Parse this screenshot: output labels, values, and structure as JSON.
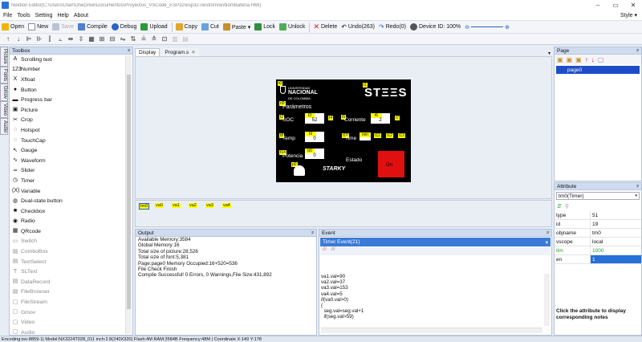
{
  "window": {
    "title": "Nextion Editor(C:\\Users\\User\\OneDrive\\Documentos\\Proyectos_VSCode_ESP32\\esp32-nextion\\nextion\\Bateria.HMI)",
    "controls": [
      "–",
      "▭",
      "✕"
    ]
  },
  "menu": {
    "items": [
      "File",
      "Tools",
      "Setting",
      "Help",
      "About"
    ],
    "style_label": "Style ▾"
  },
  "toolbar": {
    "open": "Open",
    "new": "New",
    "save": "Save",
    "compile": "Compile",
    "debug": "Debug",
    "upload": "Upload",
    "copy": "Copy",
    "cut": "Cut",
    "paste": "Paste ▾",
    "lock": "Lock",
    "unlock": "Unlock",
    "delete": "Delete",
    "undo": "Undo(263)",
    "redo": "Redo(0)",
    "device_id": "Device ID: 100%"
  },
  "left_vertical_tabs": [
    "Picture",
    "Fonts",
    "Gmov",
    "Video",
    "Audio"
  ],
  "toolbox": {
    "title": "Toolbox",
    "pin": "ᵖ",
    "items": [
      {
        "label": "Scrolling text",
        "icon": "A",
        "enabled": true
      },
      {
        "label": "Number",
        "icon": "123",
        "enabled": true
      },
      {
        "label": "Xfloat",
        "icon": "X",
        "enabled": true
      },
      {
        "label": "Button",
        "icon": "●",
        "enabled": true
      },
      {
        "label": "Progress bar",
        "icon": "▬",
        "enabled": true
      },
      {
        "label": "Picture",
        "icon": "▣",
        "enabled": true
      },
      {
        "label": "Crop",
        "icon": "✂",
        "enabled": true
      },
      {
        "label": "Hotspot",
        "icon": "◌",
        "enabled": true
      },
      {
        "label": "TouchCap",
        "icon": "◌",
        "enabled": true
      },
      {
        "label": "Gauge",
        "icon": "↖",
        "enabled": true
      },
      {
        "label": "Waveform",
        "icon": "∿",
        "enabled": true
      },
      {
        "label": "Slider",
        "icon": "≂",
        "enabled": true
      },
      {
        "label": "Timer",
        "icon": "◷",
        "enabled": true
      },
      {
        "label": "Variable",
        "icon": "(X)",
        "enabled": true
      },
      {
        "label": "Dual-state button",
        "icon": "◍",
        "enabled": true
      },
      {
        "label": "Checkbox",
        "icon": "■",
        "enabled": true
      },
      {
        "label": "Radio",
        "icon": "◉",
        "enabled": true
      },
      {
        "label": "QRcode",
        "icon": "▦",
        "enabled": true
      },
      {
        "label": "Switch",
        "icon": "▭",
        "enabled": false
      },
      {
        "label": "ComboBox",
        "icon": "▤",
        "enabled": false
      },
      {
        "label": "TextSelect",
        "icon": "▤",
        "enabled": false
      },
      {
        "label": "SLText",
        "icon": "T",
        "enabled": false
      },
      {
        "label": "DataRecord",
        "icon": "▤",
        "enabled": false
      },
      {
        "label": "FileBrowser",
        "icon": "▤",
        "enabled": false
      },
      {
        "label": "FileStream",
        "icon": "▢",
        "enabled": false
      },
      {
        "label": "Gmov",
        "icon": "▢",
        "enabled": false
      },
      {
        "label": "Video",
        "icon": "▢",
        "enabled": false
      },
      {
        "label": "Audio",
        "icon": "▢",
        "enabled": false
      }
    ]
  },
  "doc_tabs": {
    "display": "Display",
    "program": "Program.s",
    "close": "✕",
    "dropdown": "▾"
  },
  "hmi": {
    "brand_line1": "UNIVERSIDAD",
    "brand_line2": "NACIONAL",
    "brand_line3": "DE COLOMBIA",
    "logo": "STΞΞS",
    "params": "Parámetros",
    "soc": "SOC",
    "soc_val": "52",
    "corriente": "Corriente",
    "cur_val": "2",
    "temp": "Temp",
    "temp_val": "0",
    "time": "Time",
    "min": "min",
    "potencia": "Potencia",
    "pot_val": "0",
    "estado": "Estado",
    "state_box": "On",
    "shell_tag": "p0",
    "tags": [
      "t0",
      "t1",
      "n0",
      "t2",
      "t3",
      "t4",
      "t5",
      "t6",
      "t7",
      "t8",
      "t9",
      "t10",
      "t11",
      "t12",
      "t13",
      "t14",
      "b0"
    ],
    "sign": "STARKY"
  },
  "objects": [
    "tm0",
    "va0",
    "va1",
    "va2",
    "va3",
    "va4"
  ],
  "output": {
    "title": "Output",
    "lines": [
      "Available Memory:3584",
      "Global Memory:16",
      "Total size of picture:28,526",
      "Total size of font:5,381",
      "Page:page0 Memory Occupied:16+520=536",
      "File Check Finish",
      "Compile Successful! 0 Errors, 0 Warnings,File Size:431,892"
    ]
  },
  "event": {
    "title": "Event",
    "selector": "Timer Event(21)",
    "code": [
      "va1.val=90",
      "va2.val=37",
      "va3.val=153",
      "va4.val=5",
      "if(va0.val>0)",
      "{",
      "  seg.val=seg.val+1",
      "  if(seg.val>59)"
    ]
  },
  "page_panel": {
    "title": "Page",
    "item": "page0"
  },
  "attribute_panel": {
    "title": "Attribute",
    "selected": "tm0(Timer)",
    "rows": [
      {
        "k": "type",
        "v": "51",
        "style": ""
      },
      {
        "k": "id",
        "v": "19",
        "style": ""
      },
      {
        "k": "objname",
        "v": "tm0",
        "style": ""
      },
      {
        "k": "vscope",
        "v": "local",
        "style": ""
      },
      {
        "k": "tim",
        "v": "1000",
        "style": "green"
      },
      {
        "k": "en",
        "v": "1",
        "style": "sel"
      }
    ],
    "note": "Click the attribute to display corresponding notes"
  },
  "status": "Encoding:iso-8859-1| Model:NX3224T028_011 inch:2.8(240X320) Flash:4M RAM:3584B Frequency:48M | Coordinate X:149  Y:178"
}
